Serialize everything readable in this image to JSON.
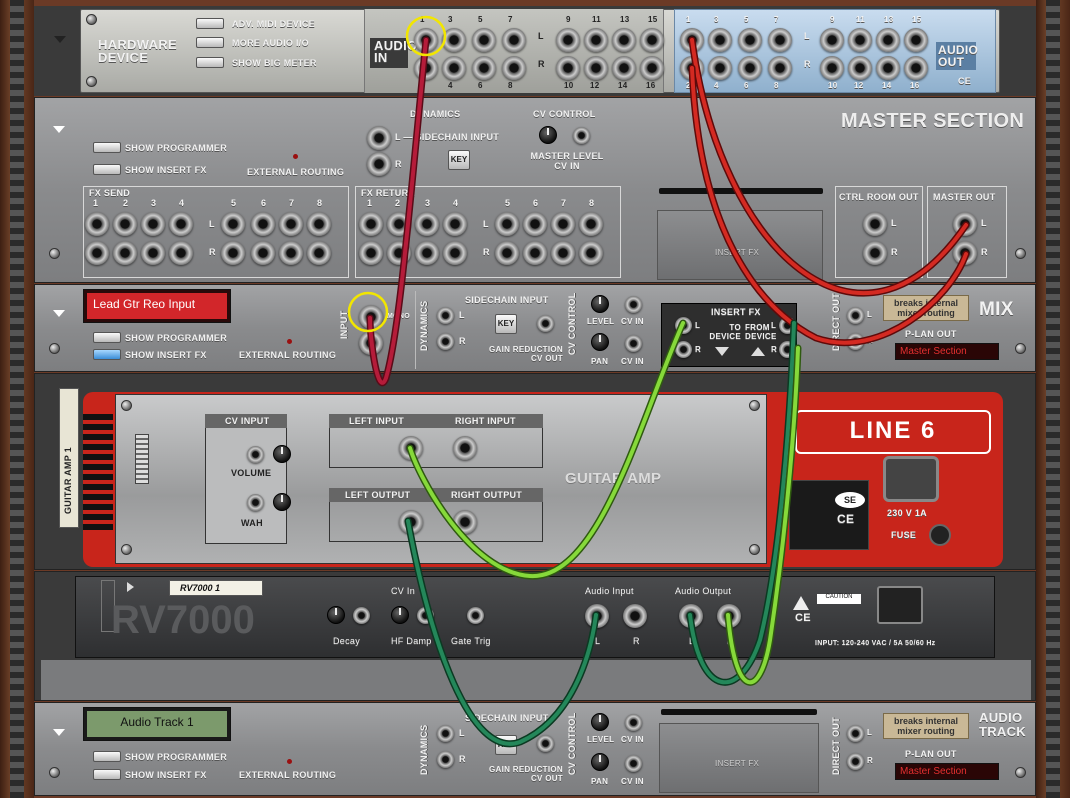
{
  "hardware": {
    "title": "HARDWARE DEVICE",
    "buttons": [
      "ADV. MIDI DEVICE",
      "MORE AUDIO I/O",
      "SHOW BIG METER"
    ],
    "audio_in": "AUDIO IN",
    "audio_out": "AUDIO OUT",
    "ce": "CE",
    "in_top": [
      "1",
      "3",
      "5",
      "7",
      "9",
      "11",
      "13",
      "15"
    ],
    "in_bottom": [
      "2",
      "4",
      "6",
      "8",
      "10",
      "12",
      "14",
      "16"
    ],
    "out_top": [
      "1",
      "3",
      "5",
      "7",
      "9",
      "11",
      "13",
      "15"
    ],
    "out_bottom": [
      "2",
      "4",
      "6",
      "8",
      "10",
      "12",
      "14",
      "16"
    ],
    "L": "L",
    "R": "R"
  },
  "master": {
    "title": "MASTER SECTION",
    "show_programmer": "SHOW PROGRAMMER",
    "show_insert_fx": "SHOW INSERT FX",
    "external_routing": "EXTERNAL ROUTING",
    "dynamics": "DYNAMICS",
    "sidechain_input": "L — SIDECHAIN INPUT",
    "cv_control": "CV CONTROL",
    "master_level_cv_in": "MASTER LEVEL CV IN",
    "key": "KEY",
    "fx_send": "FX SEND",
    "fx_return": "FX RETURN",
    "numbers_1_4": [
      "1",
      "2",
      "3",
      "4"
    ],
    "numbers_5_8": [
      "5",
      "6",
      "7",
      "8"
    ],
    "insert_fx": "INSERT FX",
    "ctrl_room_out": "CTRL ROOM OUT",
    "master_out": "MASTER OUT",
    "L": "L",
    "R": "R"
  },
  "mix": {
    "name": "Lead Gtr Reo Input",
    "show_programmer": "SHOW PROGRAMMER",
    "show_insert_fx": "SHOW INSERT FX",
    "external_routing": "EXTERNAL ROUTING",
    "input": "INPUT",
    "mono": "MONO",
    "dynamics": "DYNAMICS",
    "sidechain_input": "SIDECHAIN INPUT",
    "key": "KEY",
    "gain_reduction": "GAIN REDUCTION CV OUT",
    "cv_control": "CV CONTROL",
    "level": "LEVEL",
    "pan": "PAN",
    "cv_in": "CV IN",
    "insert_fx": "INSERT FX",
    "to_device": "TO DEVICE",
    "from_device": "FROM DEVICE",
    "direct_out": "DIRECT OUT",
    "breaks": "breaks internal mixer routing",
    "p_lan_out": "P-LAN OUT",
    "master_section": "Master Section",
    "badge": "MIX",
    "L": "L",
    "R": "R"
  },
  "guitar_amp": {
    "cv_input": "CV INPUT",
    "volume": "VOLUME",
    "wah": "WAH",
    "left_input": "LEFT INPUT",
    "right_input": "RIGHT INPUT",
    "left_output": "LEFT OUTPUT",
    "right_output": "RIGHT OUTPUT",
    "title": "GUITAR AMP",
    "brand": "LINE 6",
    "side_label": "GUITAR AMP 1",
    "voltage": "230 V 1A",
    "fuse": "FUSE",
    "ce": "CE",
    "se": "SE"
  },
  "rv7000": {
    "name": "RV7000 1",
    "logo": "RV7000",
    "cv_in": "CV In",
    "decay": "Decay",
    "hf_damp": "HF Damp",
    "gate_trig": "Gate Trig",
    "audio_input": "Audio Input",
    "audio_output": "Audio Output",
    "L": "L",
    "R": "R",
    "caution": "CAUTION",
    "input": "INPUT: 120-240 VAC / 5A 50/60 Hz",
    "ce": "CE"
  },
  "audio_track": {
    "name": "Audio Track 1",
    "show_programmer": "SHOW PROGRAMMER",
    "show_insert_fx": "SHOW INSERT FX",
    "external_routing": "EXTERNAL ROUTING",
    "dynamics": "DYNAMICS",
    "sidechain_input": "SIDECHAIN INPUT",
    "key": "KEY",
    "gain_reduction": "GAIN REDUCTION CV OUT",
    "cv_control": "CV CONTROL",
    "level": "LEVEL",
    "pan": "PAN",
    "cv_in": "CV IN",
    "insert_fx": "INSERT FX",
    "direct_out": "DIRECT OUT",
    "breaks": "breaks internal mixer routing",
    "p_lan_out": "P-LAN OUT",
    "master_section": "Master Section",
    "badge": "AUDIO TRACK",
    "L": "L",
    "R": "R"
  },
  "colors": {
    "cable_red": "#c42020",
    "cable_crimson": "#a51532",
    "cable_green": "#7fd43a",
    "cable_dark_green": "#1e7d4a",
    "highlight_ring": "#f2e600",
    "amp_red": "#c8251b",
    "rack_wood": "#6b3a26"
  }
}
